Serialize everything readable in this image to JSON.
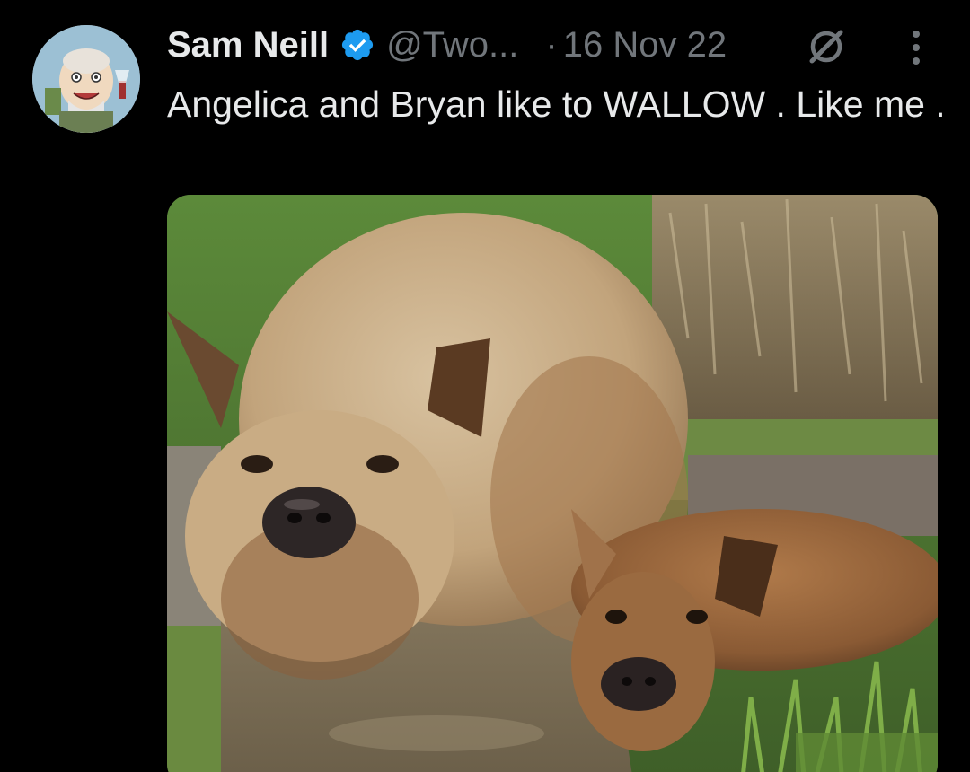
{
  "author": {
    "display_name": "Sam Neill",
    "handle": "@Two...",
    "verified_icon": "verified-badge-icon",
    "avatar_icon": "caricature-avatar"
  },
  "meta": {
    "separator": "·",
    "date": "16 Nov 22"
  },
  "actions": {
    "grok_icon": "grok-slash-icon",
    "more_icon": "more-vertical-icon"
  },
  "tweet": {
    "text": "Angelica and Bryan like to WALLOW . Like me ."
  },
  "media": {
    "description_icon": "photo-two-pigs-wallowing"
  },
  "colors": {
    "background": "#000000",
    "primary_text": "#e7e9ea",
    "secondary_text": "#71767b",
    "verified_blue": "#1d9bf0"
  }
}
